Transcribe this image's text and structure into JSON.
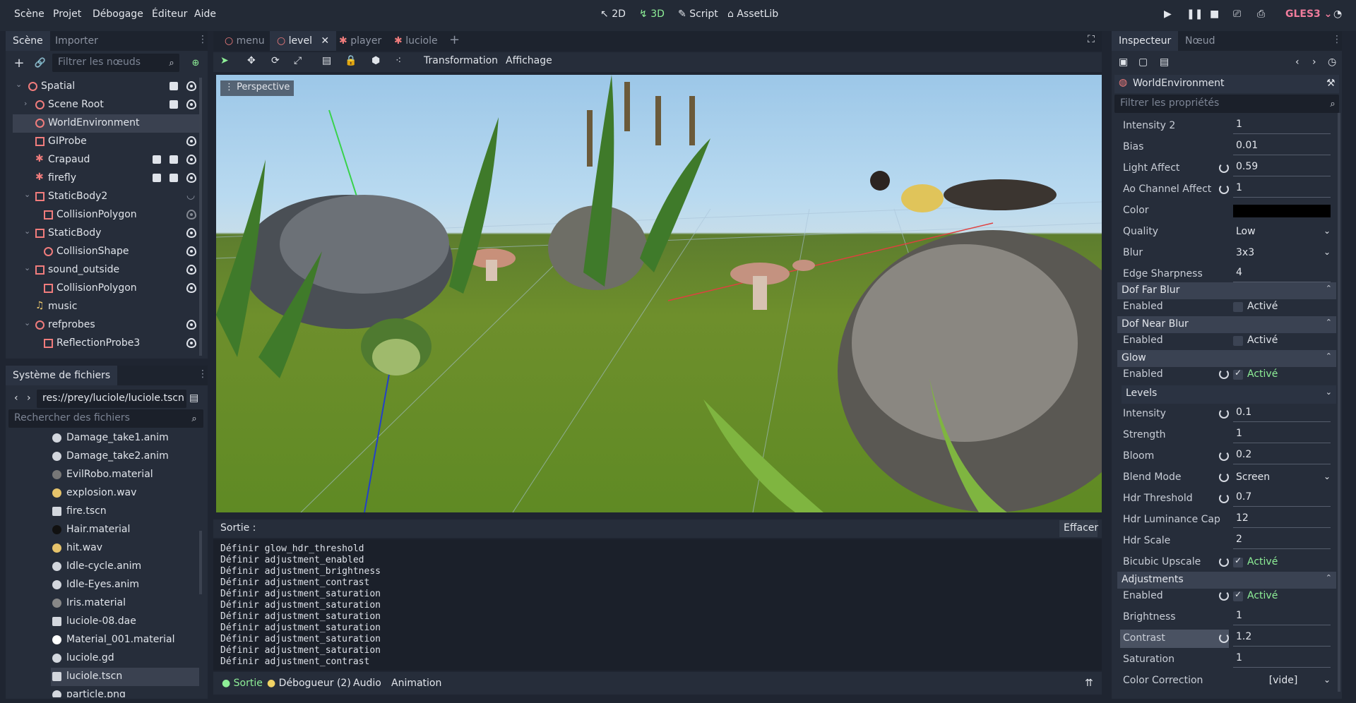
{
  "menubar": {
    "items": [
      "Scène",
      "Projet",
      "Débogage",
      "Éditeur",
      "Aide"
    ]
  },
  "modes": {
    "d2": "2D",
    "d3": "3D",
    "script": "Script",
    "assetlib": "AssetLib"
  },
  "renderer": "GLES3",
  "scene_dock": {
    "tabs": [
      "Scène",
      "Importer"
    ],
    "filter_placeholder": "Filtrer les nœuds",
    "nodes": [
      {
        "label": "Spatial"
      },
      {
        "label": "Scene Root"
      },
      {
        "label": "WorldEnvironment"
      },
      {
        "label": "GIProbe"
      },
      {
        "label": "Crapaud"
      },
      {
        "label": "firefly"
      },
      {
        "label": "StaticBody2"
      },
      {
        "label": "CollisionPolygon"
      },
      {
        "label": "StaticBody"
      },
      {
        "label": "CollisionShape"
      },
      {
        "label": "sound_outside"
      },
      {
        "label": "CollisionPolygon"
      },
      {
        "label": "music"
      },
      {
        "label": "refprobes"
      },
      {
        "label": "ReflectionProbe3"
      }
    ]
  },
  "filesystem": {
    "title": "Système de fichiers",
    "path": "res://prey/luciole/luciole.tscn",
    "search_placeholder": "Rechercher des fichiers",
    "files": [
      {
        "label": "Damage_take1.anim"
      },
      {
        "label": "Damage_take2.anim"
      },
      {
        "label": "EvilRobo.material"
      },
      {
        "label": "explosion.wav"
      },
      {
        "label": "fire.tscn"
      },
      {
        "label": "Hair.material"
      },
      {
        "label": "hit.wav"
      },
      {
        "label": "Idle-cycle.anim"
      },
      {
        "label": "Idle-Eyes.anim"
      },
      {
        "label": "Iris.material"
      },
      {
        "label": "luciole-08.dae"
      },
      {
        "label": "Material_001.material"
      },
      {
        "label": "luciole.gd"
      },
      {
        "label": "luciole.tscn"
      },
      {
        "label": "particle.png"
      }
    ]
  },
  "editor_tabs": [
    "menu",
    "level",
    "player",
    "luciole"
  ],
  "toolbar": {
    "transform": "Transformation",
    "view": "Affichage"
  },
  "viewport": {
    "label": "Perspective"
  },
  "output": {
    "title": "Sortie :",
    "clear": "Effacer",
    "lines": [
      "Définir glow_hdr_threshold",
      "Définir adjustment_enabled",
      "Définir adjustment_brightness",
      "Définir adjustment_contrast",
      "Définir adjustment_saturation",
      "Définir adjustment_saturation",
      "Définir adjustment_saturation",
      "Définir adjustment_saturation",
      "Définir adjustment_saturation",
      "Définir adjustment_saturation",
      "Définir adjustment_contrast"
    ],
    "bottom_tabs": [
      "Sortie",
      "Débogueur (2)",
      "Audio",
      "Animation"
    ]
  },
  "inspector": {
    "tabs": [
      "Inspecteur",
      "Nœud"
    ],
    "object": "WorldEnvironment",
    "filter_placeholder": "Filtrer les propriétés",
    "props": {
      "intensity2": {
        "name": "Intensity 2",
        "value": "1"
      },
      "bias": {
        "name": "Bias",
        "value": "0.01"
      },
      "light_affect": {
        "name": "Light Affect",
        "value": "0.59"
      },
      "ao_channel": {
        "name": "Ao Channel Affect",
        "value": "1"
      },
      "color": {
        "name": "Color"
      },
      "quality": {
        "name": "Quality",
        "value": "Low"
      },
      "blur": {
        "name": "Blur",
        "value": "3x3"
      },
      "edge": {
        "name": "Edge Sharpness",
        "value": "4"
      },
      "dof_far": {
        "section": "Dof Far Blur",
        "name": "Enabled",
        "value": "Activé"
      },
      "dof_near": {
        "section": "Dof Near Blur",
        "name": "Enabled",
        "value": "Activé"
      },
      "glow": {
        "section": "Glow",
        "name": "Enabled",
        "value": "Activé"
      },
      "levels": "Levels",
      "intensity": {
        "name": "Intensity",
        "value": "0.1"
      },
      "strength": {
        "name": "Strength",
        "value": "1"
      },
      "bloom": {
        "name": "Bloom",
        "value": "0.2"
      },
      "blend": {
        "name": "Blend Mode",
        "value": "Screen"
      },
      "hdr_threshold": {
        "name": "Hdr Threshold",
        "value": "0.7"
      },
      "hdr_lum": {
        "name": "Hdr Luminance Cap",
        "value": "12"
      },
      "hdr_scale": {
        "name": "Hdr Scale",
        "value": "2"
      },
      "bicubic": {
        "name": "Bicubic Upscale",
        "value": "Activé"
      },
      "adjustments": {
        "section": "Adjustments",
        "name": "Enabled",
        "value": "Activé"
      },
      "brightness": {
        "name": "Brightness",
        "value": "1"
      },
      "contrast": {
        "name": "Contrast",
        "value": "1.2"
      },
      "saturation": {
        "name": "Saturation",
        "value": "1"
      },
      "color_correction": {
        "name": "Color Correction",
        "value": "[vide]"
      }
    }
  }
}
